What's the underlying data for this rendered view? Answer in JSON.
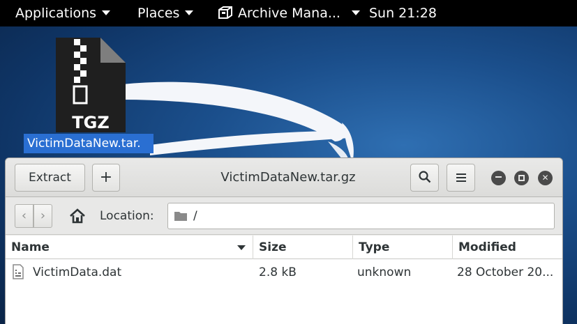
{
  "top_panel": {
    "applications": "Applications",
    "places": "Places",
    "active_app": "Archive Mana...",
    "clock": "Sun 21:28"
  },
  "desktop": {
    "icon_badge": "TGZ",
    "icon_label": "VictimDataNew.tar."
  },
  "window": {
    "title": "VictimDataNew.tar.gz",
    "extract_label": "Extract",
    "add_label": "+",
    "location_label": "Location:",
    "location_value": "/",
    "columns": [
      "Name",
      "Size",
      "Type",
      "Modified"
    ],
    "files": [
      {
        "name": "VictimData.dat",
        "size": "2.8 kB",
        "type": "unknown",
        "modified": "28 October 20..."
      }
    ]
  },
  "icons": {
    "menu_arrow": "dropdown-triangle-icon",
    "archive_manager": "archive-manager-icon",
    "search": "search-icon",
    "menu": "hamburger-menu-icon",
    "minimize": "minimize-icon",
    "maximize": "maximize-icon",
    "close": "close-icon",
    "back": "back-arrow-icon",
    "forward": "forward-arrow-icon",
    "home": "home-icon",
    "folder": "folder-icon",
    "file": "file-icon"
  },
  "colors": {
    "panel": "#000000",
    "selection": "#2a6fd2",
    "window_bg": "#e8e8e7"
  }
}
